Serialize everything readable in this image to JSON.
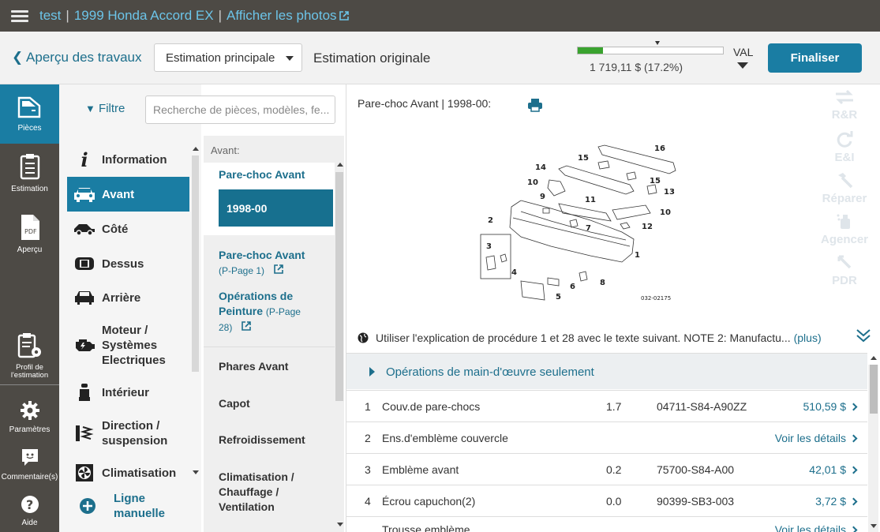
{
  "header": {
    "user": "test",
    "vehicle": "1999 Honda Accord EX",
    "photos_link": "Afficher les photos"
  },
  "toolbar": {
    "back_label": "Aperçu des travaux",
    "estimate_select": "Estimation principale",
    "original_label": "Estimation originale",
    "progress_percent": 17.2,
    "progress_text": "1 719,11 $ (17.2%)",
    "val_label": "VAL",
    "finalize_label": "Finaliser"
  },
  "leftnav": {
    "parts": "Pièces",
    "estimate": "Estimation",
    "preview": "Aperçu",
    "profile_line1": "Profil de",
    "profile_line2": "l'estimation",
    "settings": "Paramètres",
    "comments": "Commentaire(s)",
    "help": "Aide",
    "pdf_text": "PDF"
  },
  "filter": {
    "label": "Filtre",
    "search_placeholder": "Recherche de pièces, modèles, fe..."
  },
  "categories": {
    "information": "Information",
    "front": "Avant",
    "side": "Côté",
    "top": "Dessus",
    "rear": "Arrière",
    "engine_l1": "Moteur /",
    "engine_l2": "Systèmes",
    "engine_l3": "Electriques",
    "interior": "Intérieur",
    "steering_l1": "Direction /",
    "steering_l2": "suspension",
    "climate": "Climatisation",
    "manual_l1": "Ligne",
    "manual_l2": "manuelle"
  },
  "subcategories": {
    "heading": "Avant:",
    "bumper": "Pare-choc Avant",
    "year": "1998-00",
    "bumper_ref": "Pare-choc Avant",
    "bumper_ref_page": "(P-Page 1)",
    "paint_l1": "Opérations de",
    "paint_l2": "Peinture",
    "paint_page_a": "(P-Page",
    "paint_page_b": "28)",
    "headlamps": "Phares Avant",
    "hood": "Capot",
    "cooling": "Refroidissement",
    "hvac_l1": "Climatisation /",
    "hvac_l2": "Chauffage /",
    "hvac_l3": "Ventilation"
  },
  "main": {
    "part_title": "Pare-choc Avant | 1998-00:",
    "diagram_code": "032-02175",
    "diagram_callouts": [
      "1",
      "2",
      "3",
      "4",
      "5",
      "6",
      "7",
      "8",
      "9",
      "10",
      "10",
      "11",
      "12",
      "13",
      "14",
      "15",
      "15",
      "16"
    ],
    "tools": {
      "rr": "R&R",
      "ei": "E&I",
      "repair": "Réparer",
      "align": "Agencer",
      "pdr": "PDR"
    },
    "note_text": "Utiliser l'explication de procédure 1 et 28 avec le texte suivant. NOTE 2: Manufactu...",
    "note_more": "(plus)",
    "ops_label": "Opérations de main-d'œuvre seulement"
  },
  "parts_rows": [
    {
      "num": "1",
      "desc": "Couv.de pare-chocs",
      "qty": "1.7",
      "part": "04711-S84-A90ZZ",
      "price": "510,59 $"
    },
    {
      "num": "2",
      "desc": "Ens.d'emblème couvercle",
      "qty": "",
      "part": "",
      "price": "Voir les détails"
    },
    {
      "num": "3",
      "desc": "Emblème avant",
      "qty": "0.2",
      "part": "75700-S84-A00",
      "price": "42,01 $"
    },
    {
      "num": "4",
      "desc": "Écrou capuchon(2)",
      "qty": "0.0",
      "part": "90399-SB3-003",
      "price": "3,72 $"
    },
    {
      "num": "",
      "desc": "Trousse emblème",
      "qty": "",
      "part": "",
      "price": "Voir les détails"
    }
  ],
  "colors": {
    "topbar": "#4d4a45",
    "accent": "#1a7da3",
    "link": "#1d6f8c",
    "progress": "#3aa32f"
  }
}
